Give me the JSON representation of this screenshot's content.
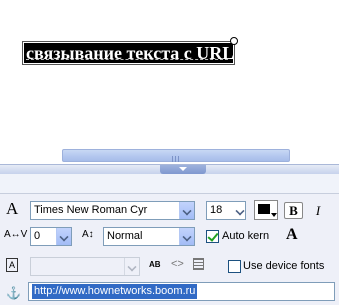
{
  "stage": {
    "text_object": "связывание текста с URL"
  },
  "properties": {
    "font_family": "Times New Roman Cyr",
    "font_size": "18",
    "fill_color": "#000000",
    "bold_label": "B",
    "italic_label": "I",
    "letter_spacing": "0",
    "baseline_position": "Normal",
    "auto_kern_label": "Auto kern",
    "auto_kern_checked": true,
    "use_device_fonts_label": "Use device fonts",
    "use_device_fonts_checked": false,
    "url": "http://www.hownetworks.boom.ru"
  },
  "icons": {
    "text_tool": "A",
    "letter_spacing": "A↔V",
    "baseline": "A↕",
    "auto_kern_tool": "A"
  }
}
